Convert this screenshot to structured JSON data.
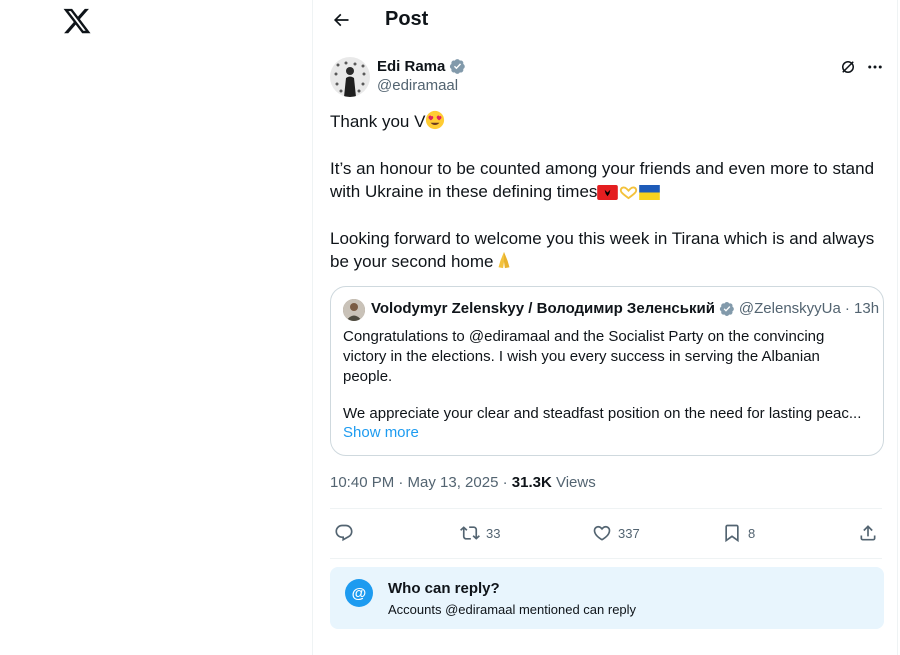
{
  "header": {
    "title": "Post"
  },
  "post": {
    "author_name": "Edi Rama",
    "author_handle": "@ediramaal",
    "p1": "Thank you V",
    "p2": "It’s an honour to be counted among your friends and even more to stand with Ukraine in these defining times",
    "p3": "Looking forward to welcome you this week in Tirana which is and always be your second home",
    "timestamp": "10:40 PM · May 13, 2025 · ",
    "views_count": "31.3K",
    "views_label": " Views"
  },
  "quote": {
    "author_name": "Volodymyr Zelenskyy / Володимир Зеленський",
    "author_handle": "@ZelenskyyUa",
    "time": " · 13h",
    "text": "Congratulations to @ediramaal and the Socialist Party on the convincing victory in the elections. I wish you every success in serving the Albanian people.",
    "text2": "We appreciate your clear and steadfast position on the need for lasting peac...",
    "show_more": "Show more"
  },
  "actions": {
    "retweets": "33",
    "likes": "337",
    "bookmarks": "8"
  },
  "reply": {
    "title": "Who can reply?",
    "subtitle": "Accounts @ediramaal mentioned can reply"
  },
  "colors": {
    "accent": "#1d9bf0",
    "verified": "#829aab",
    "reply_bg": "#e8f5fd"
  },
  "icons": [
    "x-logo",
    "back-arrow-icon",
    "verified-icon",
    "grok-icon",
    "more-icon",
    "reply-icon",
    "retweet-icon",
    "like-icon",
    "bookmark-icon",
    "share-icon",
    "at-icon"
  ]
}
